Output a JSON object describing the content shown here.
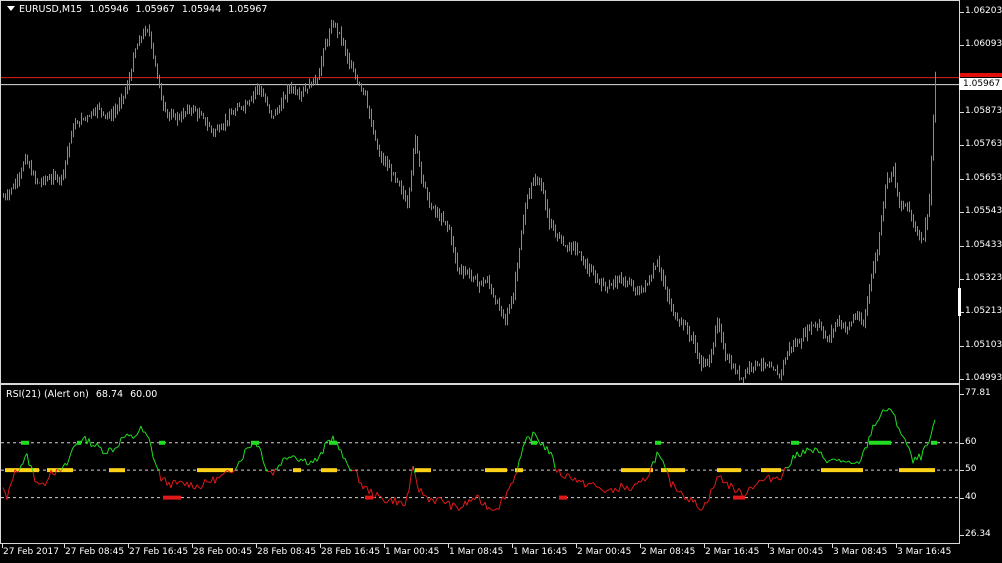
{
  "chart_header": {
    "menu_icon": "triangle-down-icon",
    "symbol": "EURUSD,M15",
    "open": "1.05946",
    "high": "1.05967",
    "low": "1.05944",
    "close": "1.05967"
  },
  "price_axis": {
    "labels": [
      "1.06203",
      "1.06093",
      "1.05873",
      "1.05763",
      "1.05653",
      "1.05543",
      "1.05433",
      "1.05323",
      "1.05213",
      "1.05103",
      "1.04993"
    ],
    "current_price": "1.05967"
  },
  "rsi_header": {
    "name": "RSI(21) (Alert on)",
    "value": "68.74",
    "level": "60.00"
  },
  "rsi_axis": {
    "labels": [
      "77.81",
      "60",
      "50",
      "40",
      "26.34"
    ]
  },
  "time_axis": {
    "labels": [
      "27 Feb 2017",
      "27 Feb 08:45",
      "27 Feb 16:45",
      "28 Feb 00:45",
      "28 Feb 08:45",
      "28 Feb 16:45",
      "1 Mar 00:45",
      "1 Mar 08:45",
      "1 Mar 16:45",
      "2 Mar 00:45",
      "2 Mar 08:45",
      "2 Mar 16:45",
      "3 Mar 00:45",
      "3 Mar 08:45",
      "3 Mar 16:45"
    ]
  },
  "colors": {
    "background": "#000000",
    "bar_bull": "#55b53a",
    "rsi_up": "#22dd22",
    "rsi_down": "#e01a1a",
    "level_neutral": "#ffd21a",
    "bid_line": "#e02020",
    "ask_line": "#dddddd",
    "grid": "#d8d8d8"
  },
  "chart_data": {
    "type": "line",
    "y_range": [
      1.04993,
      1.06203
    ],
    "price_path": [
      [
        0,
        1.0559
      ],
      [
        12,
        1.0563
      ],
      [
        24,
        1.0572
      ],
      [
        36,
        1.0564
      ],
      [
        48,
        1.0566
      ],
      [
        60,
        1.0566
      ],
      [
        72,
        1.0583
      ],
      [
        84,
        1.0586
      ],
      [
        96,
        1.0589
      ],
      [
        108,
        1.0586
      ],
      [
        118,
        1.059
      ],
      [
        126,
        1.0596
      ],
      [
        134,
        1.0608
      ],
      [
        142,
        1.0614
      ],
      [
        148,
        1.0614
      ],
      [
        154,
        1.0603
      ],
      [
        160,
        1.0592
      ],
      [
        168,
        1.0586
      ],
      [
        178,
        1.0586
      ],
      [
        190,
        1.0589
      ],
      [
        200,
        1.0586
      ],
      [
        212,
        1.0581
      ],
      [
        222,
        1.0584
      ],
      [
        234,
        1.0588
      ],
      [
        246,
        1.0591
      ],
      [
        256,
        1.0596
      ],
      [
        262,
        1.0593
      ],
      [
        270,
        1.0586
      ],
      [
        278,
        1.0589
      ],
      [
        288,
        1.0596
      ],
      [
        298,
        1.0594
      ],
      [
        306,
        1.0596
      ],
      [
        316,
        1.0599
      ],
      [
        324,
        1.061
      ],
      [
        332,
        1.0617
      ],
      [
        340,
        1.0612
      ],
      [
        348,
        1.0603
      ],
      [
        356,
        1.0598
      ],
      [
        364,
        1.0594
      ],
      [
        370,
        1.0583
      ],
      [
        378,
        1.0573
      ],
      [
        386,
        1.057
      ],
      [
        396,
        1.0564
      ],
      [
        406,
        1.0558
      ],
      [
        414,
        1.0579
      ],
      [
        420,
        1.0567
      ],
      [
        428,
        1.0557
      ],
      [
        438,
        1.0553
      ],
      [
        448,
        1.0549
      ],
      [
        456,
        1.0536
      ],
      [
        466,
        1.0535
      ],
      [
        476,
        1.0531
      ],
      [
        486,
        1.0532
      ],
      [
        496,
        1.0524
      ],
      [
        504,
        1.0519
      ],
      [
        512,
        1.0528
      ],
      [
        518,
        1.0543
      ],
      [
        526,
        1.056
      ],
      [
        534,
        1.0566
      ],
      [
        542,
        1.0562
      ],
      [
        548,
        1.055
      ],
      [
        556,
        1.0547
      ],
      [
        566,
        1.0543
      ],
      [
        574,
        1.0543
      ],
      [
        584,
        1.0537
      ],
      [
        594,
        1.0533
      ],
      [
        604,
        1.053
      ],
      [
        614,
        1.0532
      ],
      [
        624,
        1.0532
      ],
      [
        636,
        1.0528
      ],
      [
        646,
        1.0531
      ],
      [
        656,
        1.0539
      ],
      [
        664,
        1.0529
      ],
      [
        672,
        1.0521
      ],
      [
        682,
        1.0518
      ],
      [
        692,
        1.0512
      ],
      [
        700,
        1.0504
      ],
      [
        708,
        1.0506
      ],
      [
        716,
        1.0518
      ],
      [
        724,
        1.0508
      ],
      [
        732,
        1.0503
      ],
      [
        740,
        1.05
      ],
      [
        748,
        1.0504
      ],
      [
        758,
        1.0505
      ],
      [
        768,
        1.0503
      ],
      [
        778,
        1.0501
      ],
      [
        788,
        1.051
      ],
      [
        798,
        1.0512
      ],
      [
        808,
        1.0517
      ],
      [
        818,
        1.0518
      ],
      [
        826,
        1.0512
      ],
      [
        836,
        1.0519
      ],
      [
        846,
        1.0516
      ],
      [
        854,
        1.0521
      ],
      [
        862,
        1.0517
      ],
      [
        868,
        1.0531
      ],
      [
        876,
        1.0542
      ],
      [
        884,
        1.0564
      ],
      [
        892,
        1.0569
      ],
      [
        898,
        1.0556
      ],
      [
        906,
        1.0557
      ],
      [
        914,
        1.0549
      ],
      [
        922,
        1.0546
      ],
      [
        928,
        1.0559
      ],
      [
        934,
        1.0598
      ]
    ],
    "rsi_y_range": [
      26.34,
      77.81
    ],
    "rsi_levels": [
      60,
      50,
      40
    ],
    "rsi_path": [
      [
        0,
        46
      ],
      [
        6,
        39
      ],
      [
        12,
        48
      ],
      [
        18,
        51
      ],
      [
        26,
        55
      ],
      [
        34,
        47
      ],
      [
        42,
        44
      ],
      [
        50,
        50
      ],
      [
        58,
        49
      ],
      [
        66,
        52
      ],
      [
        72,
        58
      ],
      [
        78,
        61
      ],
      [
        86,
        61
      ],
      [
        94,
        59
      ],
      [
        104,
        57
      ],
      [
        114,
        58
      ],
      [
        122,
        62
      ],
      [
        132,
        62
      ],
      [
        140,
        65
      ],
      [
        148,
        61
      ],
      [
        154,
        53
      ],
      [
        160,
        47
      ],
      [
        168,
        45
      ],
      [
        178,
        45
      ],
      [
        188,
        45
      ],
      [
        198,
        44
      ],
      [
        208,
        46
      ],
      [
        218,
        47
      ],
      [
        228,
        49
      ],
      [
        238,
        53
      ],
      [
        246,
        58
      ],
      [
        254,
        61
      ],
      [
        260,
        57
      ],
      [
        266,
        50
      ],
      [
        272,
        49
      ],
      [
        280,
        53
      ],
      [
        290,
        56
      ],
      [
        300,
        54
      ],
      [
        310,
        53
      ],
      [
        318,
        54
      ],
      [
        326,
        60
      ],
      [
        332,
        62
      ],
      [
        338,
        58
      ],
      [
        344,
        53
      ],
      [
        350,
        51
      ],
      [
        356,
        48
      ],
      [
        362,
        44
      ],
      [
        370,
        42
      ],
      [
        378,
        40
      ],
      [
        386,
        39
      ],
      [
        394,
        39
      ],
      [
        404,
        37
      ],
      [
        412,
        50
      ],
      [
        418,
        43
      ],
      [
        426,
        40
      ],
      [
        434,
        39
      ],
      [
        442,
        39
      ],
      [
        450,
        37
      ],
      [
        458,
        36
      ],
      [
        466,
        38
      ],
      [
        474,
        40
      ],
      [
        482,
        38
      ],
      [
        490,
        36
      ],
      [
        498,
        37
      ],
      [
        506,
        42
      ],
      [
        514,
        48
      ],
      [
        520,
        55
      ],
      [
        526,
        61
      ],
      [
        534,
        63
      ],
      [
        540,
        60
      ],
      [
        548,
        57
      ],
      [
        556,
        50
      ],
      [
        562,
        48
      ],
      [
        570,
        48
      ],
      [
        580,
        45
      ],
      [
        590,
        45
      ],
      [
        600,
        43
      ],
      [
        610,
        42
      ],
      [
        620,
        44
      ],
      [
        630,
        43
      ],
      [
        640,
        45
      ],
      [
        648,
        49
      ],
      [
        656,
        56
      ],
      [
        662,
        52
      ],
      [
        670,
        45
      ],
      [
        678,
        43
      ],
      [
        686,
        40
      ],
      [
        694,
        38
      ],
      [
        702,
        36
      ],
      [
        710,
        42
      ],
      [
        718,
        48
      ],
      [
        726,
        45
      ],
      [
        734,
        43
      ],
      [
        742,
        41
      ],
      [
        750,
        44
      ],
      [
        760,
        46
      ],
      [
        770,
        47
      ],
      [
        780,
        48
      ],
      [
        788,
        52
      ],
      [
        796,
        56
      ],
      [
        804,
        57
      ],
      [
        814,
        57
      ],
      [
        822,
        55
      ],
      [
        830,
        53
      ],
      [
        838,
        54
      ],
      [
        846,
        52
      ],
      [
        856,
        52
      ],
      [
        864,
        57
      ],
      [
        872,
        66
      ],
      [
        880,
        70
      ],
      [
        888,
        73
      ],
      [
        896,
        67
      ],
      [
        904,
        61
      ],
      [
        912,
        53
      ],
      [
        920,
        55
      ],
      [
        928,
        60
      ],
      [
        934,
        67
      ]
    ],
    "rsi_markers": [
      {
        "level": 60,
        "x": [
          20,
          28,
          76,
          80,
          158,
          164,
          250,
          258,
          328,
          336,
          530,
          536,
          654,
          660,
          790,
          798,
          868,
          890,
          930,
          936
        ]
      },
      {
        "level": 50,
        "x": [
          4,
          38,
          46,
          72,
          108,
          124,
          196,
          232,
          292,
          300,
          320,
          336,
          414,
          430,
          484,
          506,
          514,
          522,
          620,
          652,
          660,
          684,
          716,
          740,
          760,
          780,
          820,
          862,
          898,
          934
        ]
      },
      {
        "level": 40,
        "x": [
          162,
          180,
          364,
          372,
          558,
          566,
          732,
          744
        ]
      }
    ]
  }
}
